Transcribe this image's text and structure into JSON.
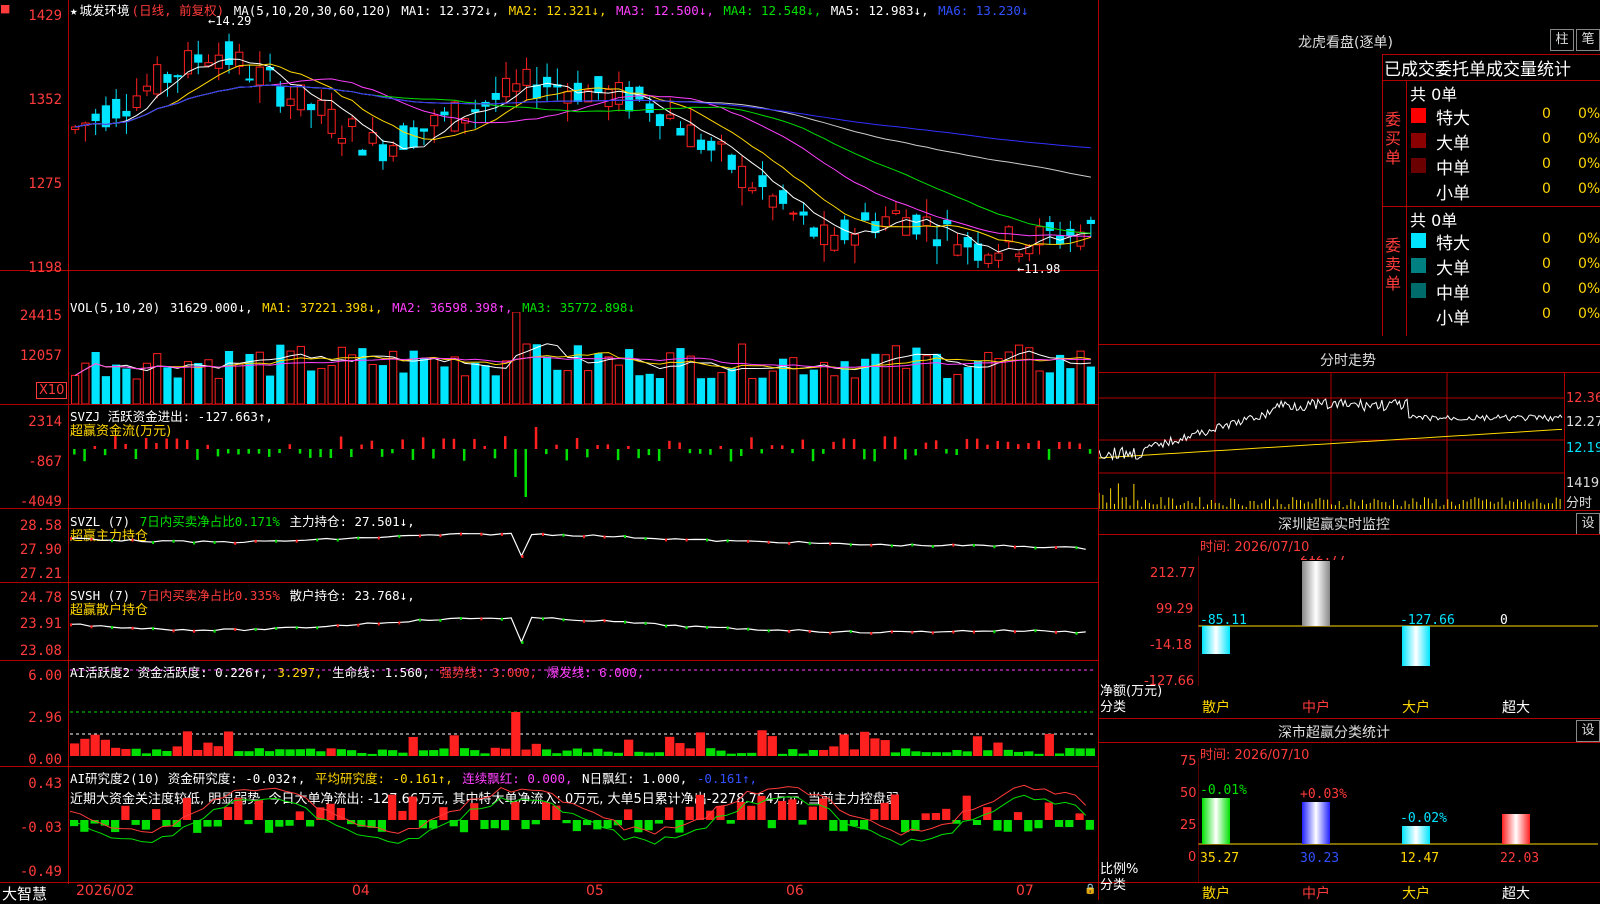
{
  "colors": {
    "up": "#ff2020",
    "down": "#00e5ff",
    "grid": "#b00000",
    "yellow": "#ffd700",
    "magenta": "#ff40ff",
    "green": "#00e000",
    "white": "#ffffff",
    "blue": "#3030ff"
  },
  "main": {
    "stock": "城发环境",
    "period": "(日线, 前复权)",
    "ma_label": "MA(5,10,20,30,60,120)",
    "ma1": "MA1: 12.372↓,",
    "ma2": "MA2: 12.321↓,",
    "ma3": "MA3: 12.500↓,",
    "ma4": "MA4: 12.548↓,",
    "ma5": "MA5: 12.983↓,",
    "ma6": "MA6: 13.230↓",
    "high_mark": "←14.29",
    "low_mark": "←11.98",
    "ylabels": [
      "1429",
      "1352",
      "1275",
      "1198"
    ]
  },
  "vol": {
    "label": "VOL(5,10,20)",
    "val": "31629.000↓,",
    "ma1": "MA1: 37221.398↓,",
    "ma2": "MA2: 36598.398↑,",
    "ma3": "MA3: 35772.898↓",
    "ylabels": [
      "24415",
      "12057"
    ],
    "unit": "X10"
  },
  "svzj": {
    "label": "SVZJ  活跃资金进出: -127.663↑,",
    "sub": "超赢资金流(万元)",
    "ylabels": [
      "2314",
      "-867",
      "-4049"
    ]
  },
  "svzl": {
    "label": "SVZL (7)",
    "a": "7日内买卖净占比0.171%",
    "b": "主力持仓: 27.501↓,",
    "sub": "超赢主力持仓",
    "ylabels": [
      "28.58",
      "27.90",
      "27.21"
    ]
  },
  "svsh": {
    "label": "SVSH (7)",
    "a": "7日内买卖净占比0.335%",
    "b": "散户持仓: 23.768↓,",
    "sub": "超赢散户持仓",
    "ylabels": [
      "24.78",
      "23.91",
      "23.08"
    ]
  },
  "ai1": {
    "label": "AI活跃度2 资金活跃度: 0.226↑,",
    "b": "3.297,",
    "c": "生命线: 1.560,",
    "d": "强势线: 3.000,",
    "e": "爆发线: 6.000,",
    "ylabels": [
      "6.00",
      "2.96",
      "0.00"
    ]
  },
  "ai2": {
    "label": "AI研究度2(10) 资金研究度: -0.032↑,",
    "b": "平均研究度: -0.161↑,",
    "c": "连续飘红: 0.000,",
    "d": "N日飘红: 1.000,",
    "e": "-0.161↑,",
    "text": "近期大资金关注度较低, 明显弱势, 今日大单净流出: -127.66万元, 其中特大单净流入: 0万元, 大单5日累计净出-2278.754万元, 当前主力控盘弱",
    "ylabels": [
      "0.43",
      "-0.03",
      "-0.49"
    ]
  },
  "xaxis": {
    "app": "大智慧",
    "labels": [
      "2026/02",
      "04",
      "05",
      "06",
      "07"
    ]
  },
  "right": {
    "title": "龙虎看盘(逐单)",
    "btn1": "柱",
    "btn2": "笔",
    "sec_title": "已成交委托单成交量统计",
    "buy_side": "委买单",
    "sell_side": "委卖单",
    "buy_total": "共 0单",
    "sell_total": "共 0单",
    "buy_rows": [
      {
        "name": "特大",
        "val": "0",
        "pct": "0%"
      },
      {
        "name": "大单",
        "val": "0",
        "pct": "0%"
      },
      {
        "name": "中单",
        "val": "0",
        "pct": "0%"
      },
      {
        "name": "小单",
        "val": "0",
        "pct": "0%"
      }
    ],
    "sell_rows": [
      {
        "name": "特大",
        "val": "0",
        "pct": "0%"
      },
      {
        "name": "大单",
        "val": "0",
        "pct": "0%"
      },
      {
        "name": "中单",
        "val": "0",
        "pct": "0%"
      },
      {
        "name": "小单",
        "val": "0",
        "pct": "0%"
      }
    ],
    "intraday_title": "分时走势",
    "intraday_y": [
      "12.36",
      "12.27",
      "12.19"
    ],
    "intraday_vol": "1419",
    "intraday_vol_label": "分时",
    "monitor_title": "深圳超赢实时监控",
    "set": "设",
    "time": "时间: 2026/07/10",
    "monitor_y": [
      "212.77",
      "99.29",
      "-14.18",
      "-127.66"
    ],
    "monitor_vals": [
      "-85.11",
      "212.77",
      "-127.66",
      "0"
    ],
    "monitor_unit": "净额(万元)",
    "monitor_cat": "分类",
    "cats": [
      "散户",
      "中户",
      "大户",
      "超大"
    ],
    "stat_title": "深市超赢分类统计",
    "stat_time": "时间: 2026/07/10",
    "stat_y": [
      "75",
      "50",
      "25",
      "0"
    ],
    "stat_pct": [
      "-0.01%",
      "+0.03%",
      "-0.02%"
    ],
    "stat_vals": [
      "35.27",
      "30.23",
      "12.47",
      "22.03"
    ],
    "stat_unit": "比例%",
    "stat_cat": "分类"
  }
}
